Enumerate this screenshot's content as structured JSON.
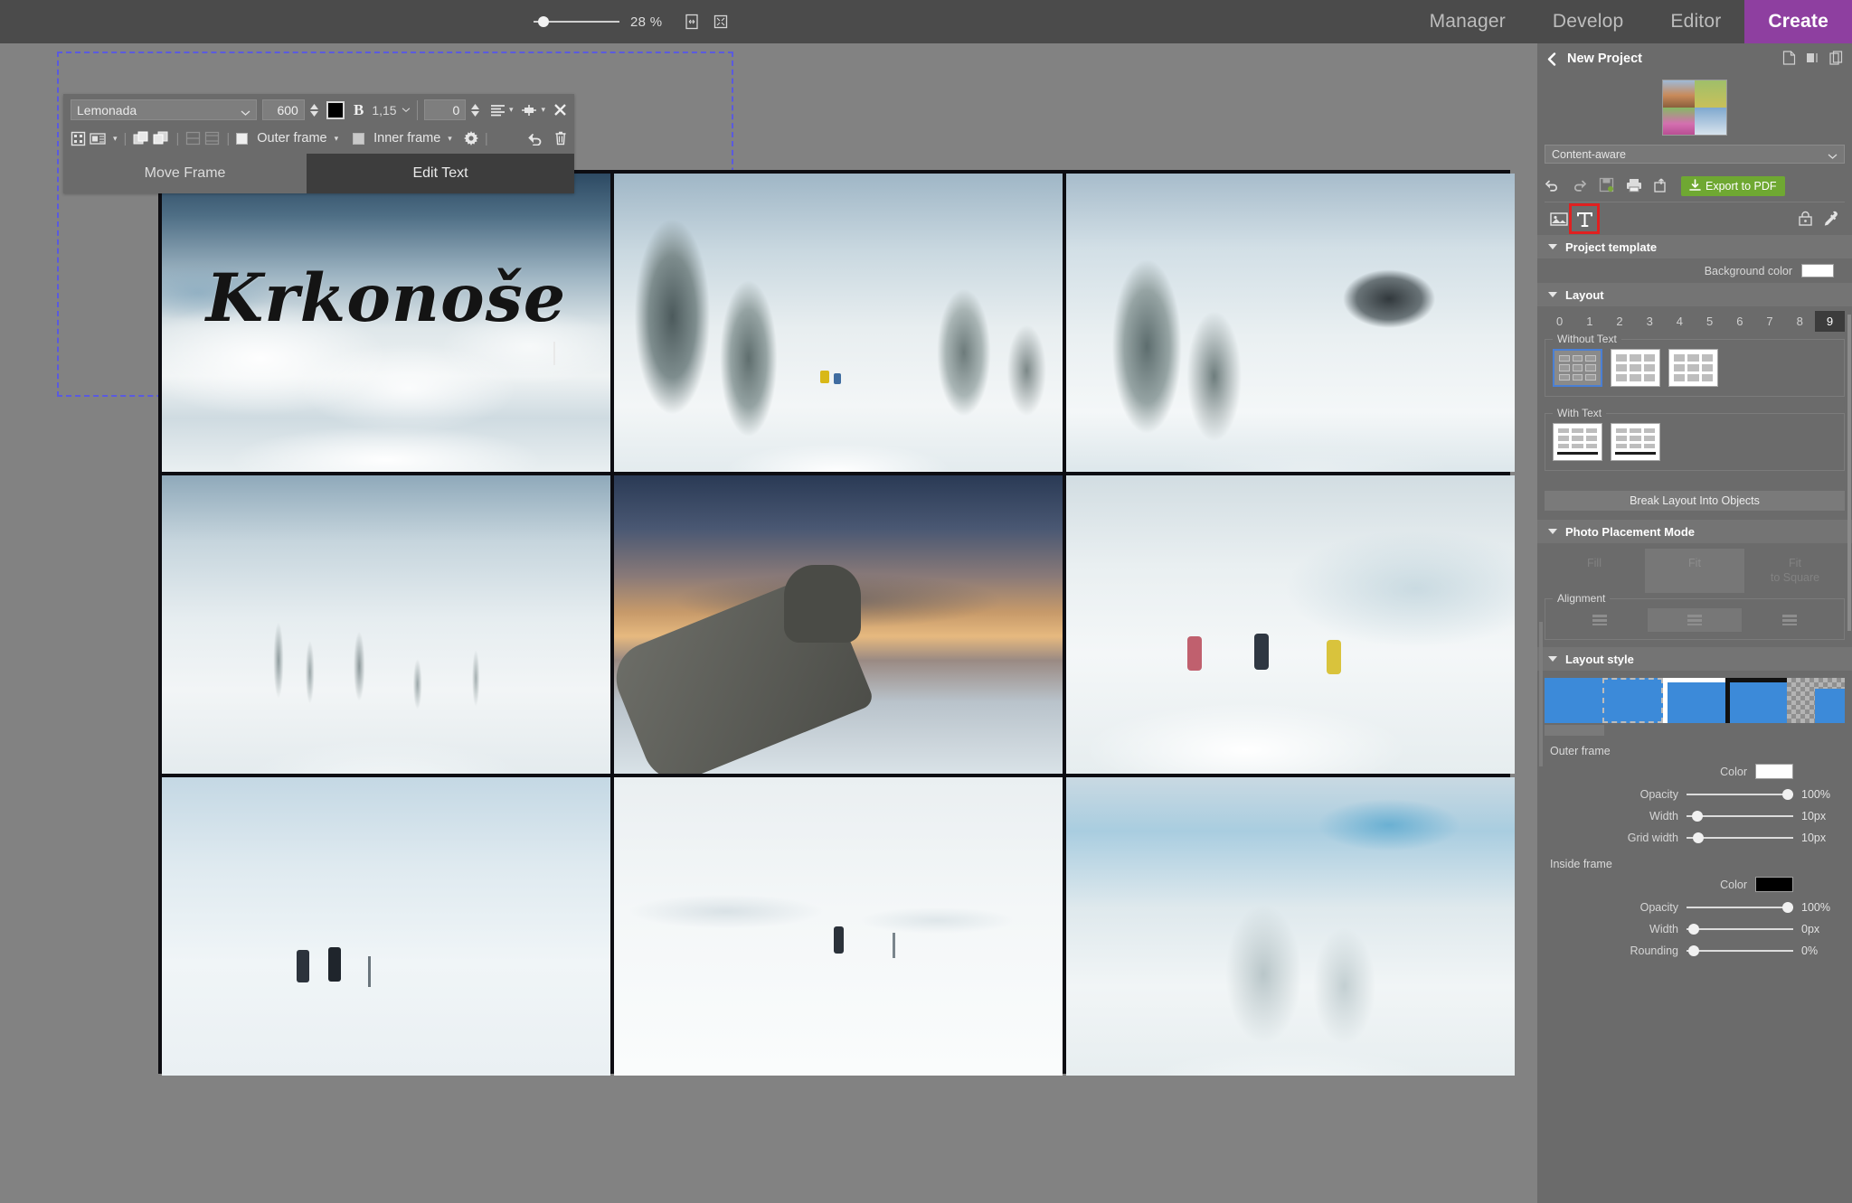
{
  "topbar": {
    "zoom_percent": "28 %",
    "fit_icon": "fit-width-icon",
    "fullscreen_icon": "fit-page-icon",
    "nav": [
      {
        "label": "Manager",
        "active": false
      },
      {
        "label": "Develop",
        "active": false
      },
      {
        "label": "Editor",
        "active": false
      },
      {
        "label": "Create",
        "active": true
      }
    ],
    "accent_color": "#8e3fa0"
  },
  "text_toolbar": {
    "font_family": "Lemonada",
    "font_size": "600",
    "text_color": "#000000",
    "bold_label": "B",
    "line_height": "1,15",
    "letter_spacing": "0",
    "align_icon": "text-align-icon",
    "vertical_align_icon": "vertical-align-icon",
    "close_icon": "close-icon",
    "row2": {
      "fit_icon": "fit-frame-icon",
      "text_flow_icon": "text-flow-icon",
      "bring_forward_icon": "bring-forward-icon",
      "send_backward_icon": "send-backward-icon",
      "distribute_h_icon": "distribute-horizontal-icon",
      "distribute_v_icon": "distribute-vertical-icon",
      "outer_frame_label": "Outer frame",
      "inner_frame_label": "Inner frame",
      "settings_icon": "gear-icon",
      "undo_icon": "undo-icon",
      "delete_icon": "trash-icon"
    },
    "move_frame_label": "Move Frame",
    "edit_text_label": "Edit Text",
    "edit_text_active": true
  },
  "canvas": {
    "overlay_text": "Krkonoše",
    "selection_visible": true,
    "cells": [
      {
        "name": "photo-snowy-sky-with-title"
      },
      {
        "name": "photo-snowy-trees-path"
      },
      {
        "name": "photo-snow-covered-forest-lodge"
      },
      {
        "name": "photo-frozen-branches-ridge"
      },
      {
        "name": "photo-hand-sunset-snow"
      },
      {
        "name": "photo-three-hikers-snow"
      },
      {
        "name": "photo-two-hikers-signpost"
      },
      {
        "name": "photo-lone-hiker-white-field"
      },
      {
        "name": "photo-snow-covered-trees-blue-sky"
      }
    ]
  },
  "panel": {
    "back_icon": "chevron-left-icon",
    "project_title": "New Project",
    "header_icons": [
      "new-page-icon",
      "page-numbering-icon",
      "duplicate-page-icon"
    ],
    "template_dropdown": "Content-aware",
    "tools": {
      "undo_icon": "undo-icon",
      "redo_icon": "redo-icon",
      "save_icon": "save-icon",
      "print_icon": "print-icon",
      "share_icon": "share-icon",
      "export_label": "Export to PDF",
      "export_color": "#6fa832"
    },
    "mode": {
      "image_icon": "image-mode-icon",
      "text_icon": "text-mode-icon",
      "text_icon_highlighted": true,
      "highlight_color": "#e02020",
      "lock_icon": "lock-icon",
      "eyedropper_icon": "eyedropper-icon"
    },
    "project_template": {
      "title": "Project template",
      "background_color_label": "Background color",
      "background_color": "#ffffff"
    },
    "layout": {
      "title": "Layout",
      "counts": [
        "0",
        "1",
        "2",
        "3",
        "4",
        "5",
        "6",
        "7",
        "8",
        "9"
      ],
      "selected_count": "9",
      "without_text_label": "Without Text",
      "without_text_tiles": 3,
      "without_text_selected": 0,
      "with_text_label": "With Text",
      "with_text_tiles": 2,
      "break_layout_label": "Break Layout Into Objects"
    },
    "photo_placement": {
      "title": "Photo Placement Mode",
      "options": [
        "Fill",
        "Fit",
        "Fit\nto Square"
      ],
      "selected": "Fit",
      "alignment_label": "Alignment",
      "alignment_selected": 1
    },
    "layout_style": {
      "title": "Layout style",
      "swatch_count": 5,
      "swatch_color": "#3c8ad9"
    },
    "outer_frame": {
      "title": "Outer frame",
      "color_label": "Color",
      "color": "#ffffff",
      "opacity_label": "Opacity",
      "opacity_value": "100%",
      "opacity_pct": 100,
      "width_label": "Width",
      "width_value": "10px",
      "width_pct": 5,
      "grid_width_label": "Grid width",
      "grid_width_value": "10px",
      "grid_width_pct": 6
    },
    "inside_frame": {
      "title": "Inside frame",
      "color_label": "Color",
      "color": "#000000",
      "opacity_label": "Opacity",
      "opacity_value": "100%",
      "opacity_pct": 100,
      "width_label": "Width",
      "width_value": "0px",
      "width_pct": 2,
      "rounding_label": "Rounding",
      "rounding_value": "0%",
      "rounding_pct": 2
    }
  }
}
